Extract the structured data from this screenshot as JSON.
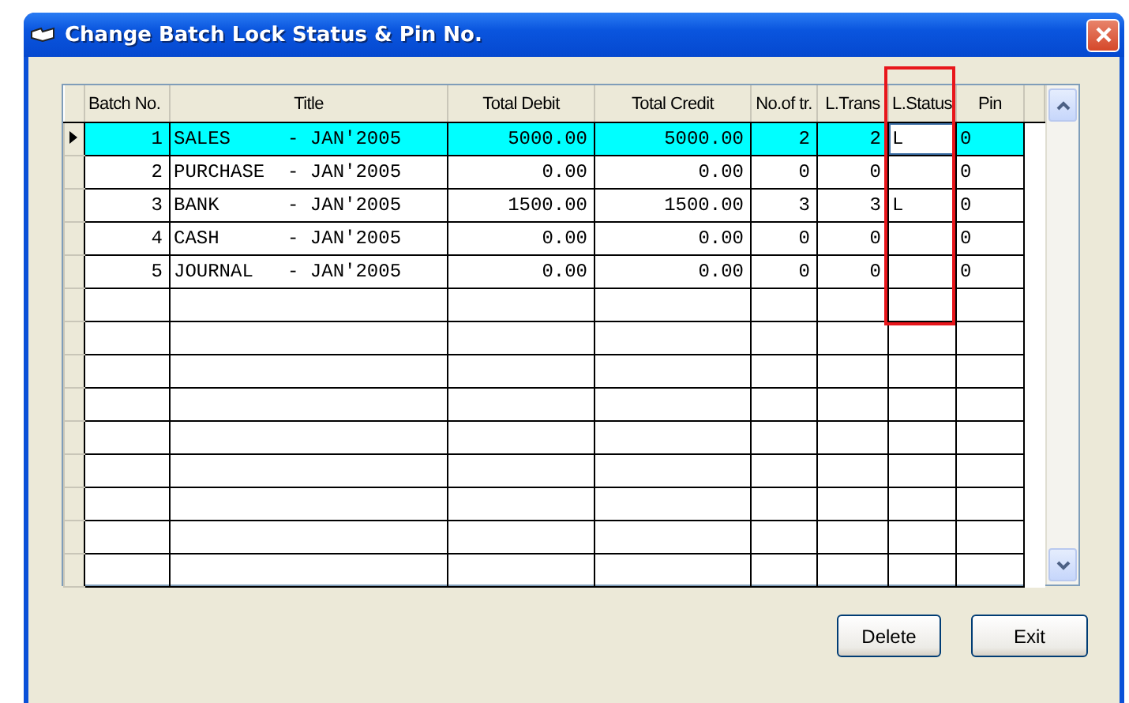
{
  "window": {
    "title": "Change Batch Lock Status & Pin No."
  },
  "grid": {
    "columns": [
      {
        "label": "Batch No.",
        "highlighted": false
      },
      {
        "label": "Title",
        "highlighted": false
      },
      {
        "label": "Total Debit",
        "highlighted": false
      },
      {
        "label": "Total Credit",
        "highlighted": false
      },
      {
        "label": "No.of tr.",
        "highlighted": false
      },
      {
        "label": "L.Trans",
        "highlighted": false
      },
      {
        "label": "L.Status",
        "highlighted": true
      },
      {
        "label": "Pin",
        "highlighted": false
      }
    ],
    "rows": [
      {
        "selected": true,
        "current": true,
        "editing": true,
        "cells": [
          "1",
          "SALES     - JAN'2005",
          "5000.00",
          "5000.00",
          "2",
          "2",
          "L",
          "0"
        ]
      },
      {
        "selected": false,
        "current": false,
        "editing": false,
        "cells": [
          "2",
          "PURCHASE  - JAN'2005",
          "0.00",
          "0.00",
          "0",
          "0",
          "",
          "0"
        ]
      },
      {
        "selected": false,
        "current": false,
        "editing": false,
        "cells": [
          "3",
          "BANK      - JAN'2005",
          "1500.00",
          "1500.00",
          "3",
          "3",
          "L",
          "0"
        ]
      },
      {
        "selected": false,
        "current": false,
        "editing": false,
        "cells": [
          "4",
          "CASH      - JAN'2005",
          "0.00",
          "0.00",
          "0",
          "0",
          "",
          "0"
        ]
      },
      {
        "selected": false,
        "current": false,
        "editing": false,
        "cells": [
          "5",
          "JOURNAL   - JAN'2005",
          "0.00",
          "0.00",
          "0",
          "0",
          "",
          "0"
        ]
      }
    ]
  },
  "buttons": [
    "Delete",
    "Exit"
  ]
}
